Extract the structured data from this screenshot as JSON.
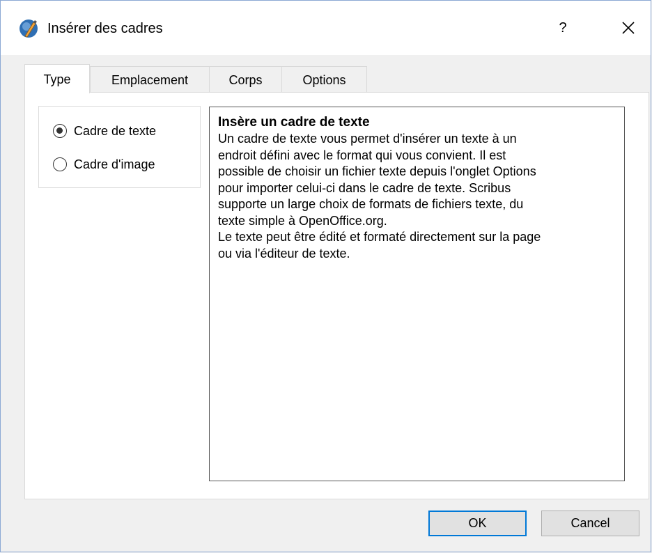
{
  "window": {
    "title": "Insérer des cadres",
    "help_label": "?",
    "icons": {
      "app": "scribus-app-icon",
      "close": "close-icon"
    }
  },
  "tabs": [
    {
      "label": "Type",
      "active": true
    },
    {
      "label": "Emplacement",
      "active": false
    },
    {
      "label": "Corps",
      "active": false
    },
    {
      "label": "Options",
      "active": false
    }
  ],
  "frame_type": {
    "options": [
      {
        "label": "Cadre de texte",
        "checked": true
      },
      {
        "label": "Cadre d'image",
        "checked": false
      }
    ]
  },
  "description": {
    "title": "Insère un cadre de texte",
    "lines": [
      "Un cadre de texte vous permet d'insérer un texte à un",
      "endroit défini avec le format qui vous convient. Il est",
      "possible de choisir un fichier texte depuis l'onglet Options",
      "pour importer celui-ci dans le cadre de texte. Scribus",
      "supporte un large choix de formats de fichiers texte, du",
      "texte simple à OpenOffice.org.",
      "Le texte peut être édité et formaté directement sur la page",
      "ou via l'éditeur de texte."
    ]
  },
  "buttons": {
    "ok": "OK",
    "cancel": "Cancel"
  },
  "colors": {
    "accent": "#0078d7",
    "panel": "#ffffff",
    "dialog_bg": "#f0f0f0"
  }
}
